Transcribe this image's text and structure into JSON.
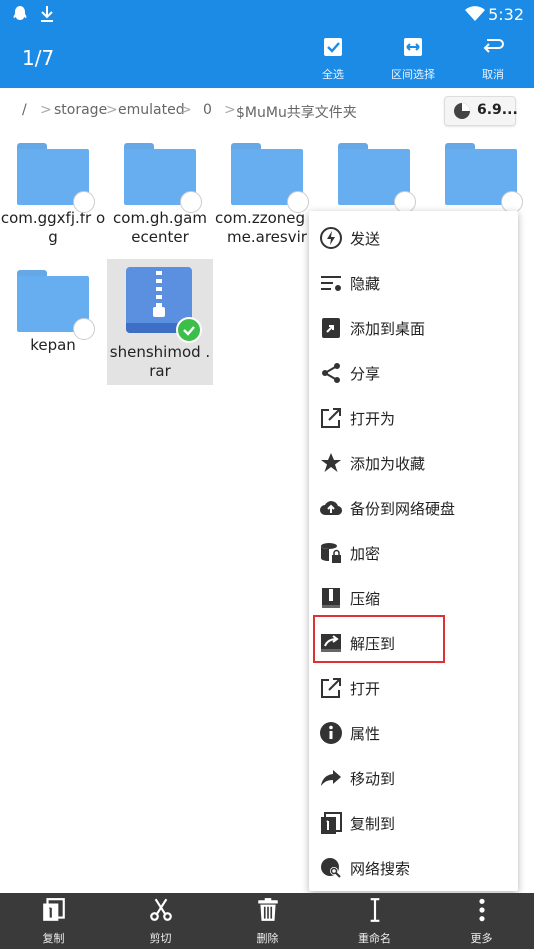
{
  "status": {
    "time": "5:32",
    "icons": [
      "qq-icon",
      "download-icon",
      "wifi-icon",
      "signal-icon",
      "battery-icon"
    ]
  },
  "appbar": {
    "title": "1/7",
    "select_all": "全选",
    "range_select": "区间选择",
    "cancel": "取消"
  },
  "breadcrumb": {
    "root": "/",
    "parts": [
      "storage",
      "emulated",
      "0",
      "$MuMu共享文件夹"
    ],
    "storage": "6.9..."
  },
  "files": [
    {
      "name": "com.ggxfj.fr og",
      "type": "folder"
    },
    {
      "name": "com.gh.gam ecenter",
      "type": "folder"
    },
    {
      "name": "com.zzoneg ame.aresvir",
      "type": "folder"
    },
    {
      "name": "",
      "type": "folder"
    },
    {
      "name": "",
      "type": "folder"
    },
    {
      "name": "kepan",
      "type": "folder"
    },
    {
      "name": "shenshimod .rar",
      "type": "archive",
      "selected": true
    }
  ],
  "menu": [
    {
      "label": "发送",
      "icon": "send-icon"
    },
    {
      "label": "隐藏",
      "icon": "hide-icon"
    },
    {
      "label": "添加到桌面",
      "icon": "add-to-desktop-icon"
    },
    {
      "label": "分享",
      "icon": "share-icon"
    },
    {
      "label": "打开为",
      "icon": "open-as-icon"
    },
    {
      "label": "添加为收藏",
      "icon": "star-icon"
    },
    {
      "label": "备份到网络硬盘",
      "icon": "cloud-upload-icon"
    },
    {
      "label": "加密",
      "icon": "encrypt-icon"
    },
    {
      "label": "压缩",
      "icon": "compress-icon"
    },
    {
      "label": "解压到",
      "icon": "extract-icon"
    },
    {
      "label": "打开",
      "icon": "open-icon"
    },
    {
      "label": "属性",
      "icon": "info-icon"
    },
    {
      "label": "移动到",
      "icon": "move-icon"
    },
    {
      "label": "复制到",
      "icon": "copy-to-icon"
    },
    {
      "label": "网络搜索",
      "icon": "web-search-icon"
    }
  ],
  "bottombar": {
    "copy": "复制",
    "cut": "剪切",
    "delete": "删除",
    "rename": "重命名",
    "more": "更多"
  },
  "colors": {
    "primary": "#1c8be6",
    "folder": "#66aef0",
    "highlight": "#e03030",
    "bottombar": "#3a3a3a"
  }
}
